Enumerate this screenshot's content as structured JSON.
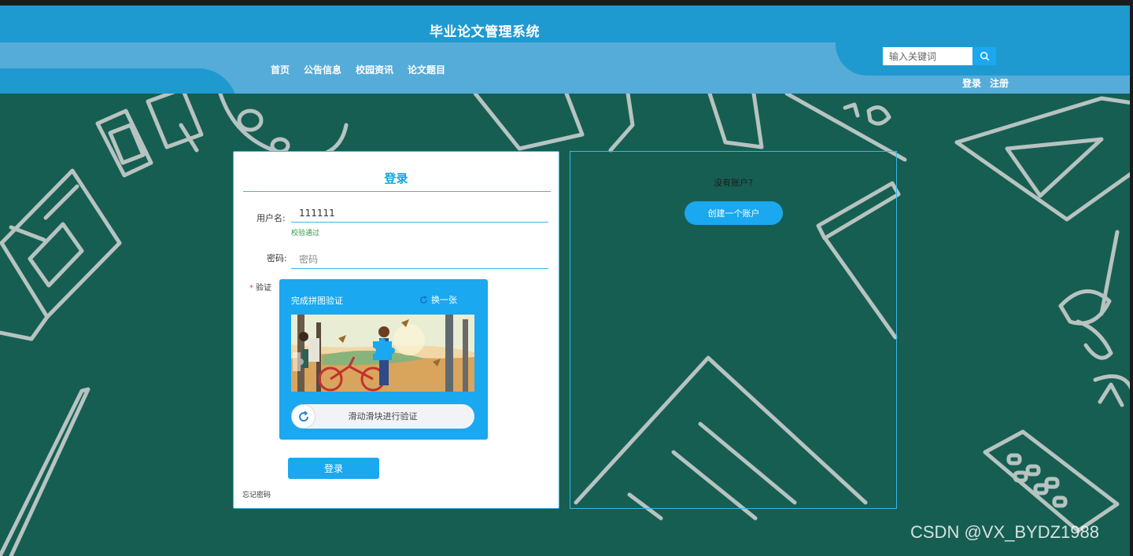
{
  "header": {
    "site_title": "毕业论文管理系统",
    "nav": [
      "首页",
      "公告信息",
      "校园资讯",
      "论文题目"
    ],
    "search": {
      "placeholder": "输入关键词"
    },
    "auth": {
      "login": "登录",
      "register": "注册"
    }
  },
  "login": {
    "title": "登录",
    "username_label": "用户名:",
    "username_value": "111111",
    "validation_message": "校验通过",
    "password_label": "密码:",
    "password_placeholder": "密码",
    "captcha_label": "验证",
    "captcha_required_mark": "*",
    "captcha": {
      "title": "完成拼图验证",
      "refresh": "换一张",
      "slider_text": "滑动滑块进行验证"
    },
    "submit": "登录",
    "forgot": "忘记密码"
  },
  "register": {
    "prompt": "没有账户?",
    "create_button": "创建一个账户"
  },
  "watermark": "CSDN @VX_BYDZ1988",
  "colors": {
    "header": "#1f9ad0",
    "nav_band": "#55acd9",
    "accent": "#1aa8f0",
    "background": "#165e52",
    "valid_text": "#2e9b48"
  },
  "icons": [
    "search-icon",
    "refresh-icon",
    "slider-refresh-icon"
  ]
}
